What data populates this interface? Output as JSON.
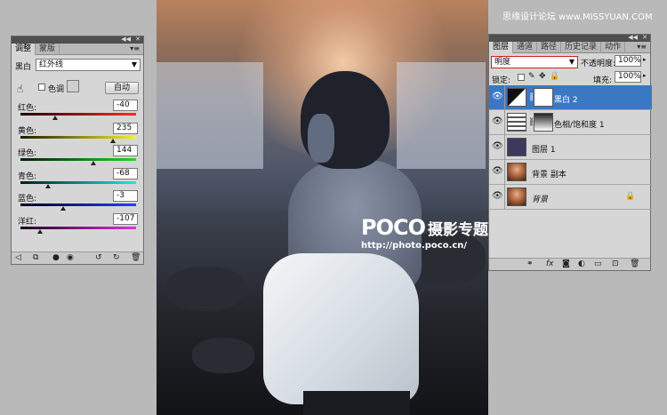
{
  "site_watermark": "思缘设计论坛  www.MISSYUAN.COM",
  "photo_watermark": {
    "brand": "POCO",
    "subtitle": "摄影专题",
    "url": "http://photo.poco.cn/"
  },
  "adjustments": {
    "tabs": [
      "调整",
      "蒙版"
    ],
    "preset_label": "黑白",
    "preset_value": "红外线",
    "tint_label": "色调",
    "auto_label": "自动",
    "sliders": [
      {
        "label": "红色:",
        "value": "-40",
        "color_start": "#1a0000",
        "color_end": "#ff2a2a",
        "fraction": 0.3
      },
      {
        "label": "黄色:",
        "value": "235",
        "color_start": "#1a1a00",
        "color_end": "#f6f22a",
        "fraction": 0.8
      },
      {
        "label": "绿色:",
        "value": "144",
        "color_start": "#001a00",
        "color_end": "#27d42f",
        "fraction": 0.63
      },
      {
        "label": "青色:",
        "value": "-68",
        "color_start": "#001a1a",
        "color_end": "#23e6e6",
        "fraction": 0.24
      },
      {
        "label": "蓝色:",
        "value": "-3",
        "color_start": "#00001a",
        "color_end": "#2a3cff",
        "fraction": 0.37
      },
      {
        "label": "洋红:",
        "value": "-107",
        "color_start": "#1a001a",
        "color_end": "#e62ee6",
        "fraction": 0.17
      }
    ],
    "bottom_icons": [
      "back-arrow-icon",
      "layer-clip-icon",
      "mask-icon",
      "eye-icon",
      "reset-icon",
      "refresh-icon",
      "trash-icon"
    ]
  },
  "layers": {
    "tabs": [
      "图层",
      "通道",
      "路径",
      "历史记录",
      "动作"
    ],
    "blend_mode": "明度",
    "opacity_label": "不透明度:",
    "opacity_value": "100%",
    "lock_label": "锁定:",
    "fill_label": "填充:",
    "fill_value": "100%",
    "items": [
      {
        "name": "黑白 2",
        "selected": true,
        "type": "adjustment-bw",
        "has_mask": true
      },
      {
        "name": "色相/饱和度 1",
        "selected": false,
        "type": "adjustment-hue",
        "has_mask": true
      },
      {
        "name": "图层 1",
        "selected": false,
        "type": "fill",
        "color": "#3c3a5c"
      },
      {
        "name": "背景 副本",
        "selected": false,
        "type": "photo"
      },
      {
        "name": "背景",
        "selected": false,
        "type": "photo",
        "locked": true
      }
    ],
    "bottom_icons": [
      "link-icon",
      "fx-icon",
      "add-mask-icon",
      "adjustment-icon",
      "group-icon",
      "new-layer-icon",
      "trash-icon"
    ]
  },
  "colors": {
    "selected_row": "#3b78c4",
    "panel_bg": "#d6d6d6",
    "workspace_bg": "#b9b9b9"
  }
}
